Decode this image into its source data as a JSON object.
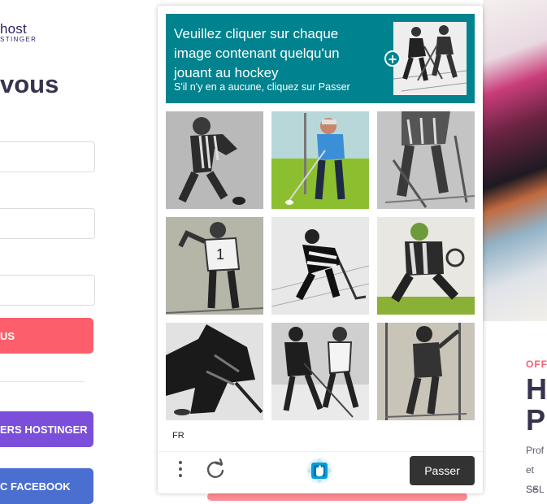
{
  "background_page": {
    "logo_line1": "host",
    "logo_line2": "STINGER",
    "heading": "vous",
    "submit_label": "US",
    "hostinger_label": "ERS HOSTINGER",
    "facebook_label": "C FACEBOOK",
    "promo_tag": "OFF",
    "promo_heading_1": "H",
    "promo_heading_2": "Pl",
    "promo_text_1": "Prof",
    "promo_text_2": "et Se",
    "promo_text_3": "SSL",
    "colors": {
      "primary": "#fc5f6b",
      "hostinger": "#7b4fd9",
      "facebook": "#4a6fd1",
      "heading": "#36344d"
    }
  },
  "captcha": {
    "prompt_title": "Veuillez cliquer sur chaque image contenant quelqu'un jouant au hockey",
    "prompt_subtitle": "S'il n'y en a aucune, cliquez sur Passer",
    "language": "FR",
    "skip_label": "Passer",
    "accent_color": "#00838f",
    "icons": {
      "example_expand": "plus-icon",
      "menu": "menu-dots-icon",
      "refresh": "refresh-icon",
      "brand": "hcaptcha-logo-icon"
    },
    "tiles": [
      {
        "subject": "hockey player skating, greyscale"
      },
      {
        "subject": "golfer in blue shirt on green"
      },
      {
        "subject": "hockey player legs with stick, greyscale"
      },
      {
        "subject": "player in white jersey, greyscale"
      },
      {
        "subject": "hockey player crouching, greyscale"
      },
      {
        "subject": "goalie on green ground"
      },
      {
        "subject": "hockey player bent over, dark sketch"
      },
      {
        "subject": "hockey players on ice, sketch"
      },
      {
        "subject": "player swinging, sepia"
      }
    ]
  }
}
